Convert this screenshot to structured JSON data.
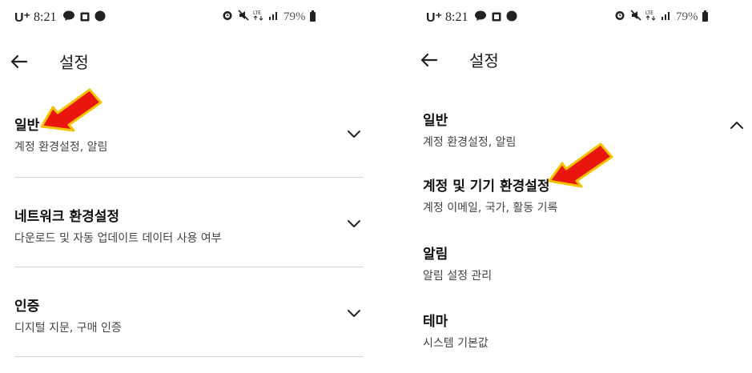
{
  "left": {
    "status": {
      "carrier": "U⁺",
      "time": "8:21",
      "battery": "79%"
    },
    "header": {
      "title": "설정"
    },
    "sections": [
      {
        "title": "일반",
        "subtitle": "계정 환경설정, 알림"
      },
      {
        "title": "네트워크 환경설정",
        "subtitle": "다운로드 및 자동 업데이트 데이터 사용 여부"
      },
      {
        "title": "인증",
        "subtitle": "디지털 지문, 구매 인증"
      }
    ]
  },
  "right": {
    "status": {
      "carrier": "U⁺",
      "time": "8:21",
      "battery": "79%"
    },
    "header": {
      "title": "설정"
    },
    "general": {
      "title": "일반",
      "subtitle": "계정 환경설정, 알림"
    },
    "subitems": [
      {
        "title": "계정 및 기기 환경설정",
        "subtitle": "계정 이메일, 국가, 활동 기록"
      },
      {
        "title": "알림",
        "subtitle": "알림 설정 관리"
      },
      {
        "title": "테마",
        "subtitle": "시스템 기본값"
      }
    ]
  },
  "colors": {
    "arrow_fill": "#e8160c",
    "arrow_outline": "#f5c400",
    "divider": "#d6d6d6"
  },
  "icons": [
    "back-arrow-icon",
    "chevron-down-icon",
    "chevron-up-icon",
    "alarm-icon",
    "mute-icon",
    "signal-icon",
    "battery-icon",
    "chat-icon",
    "talk-icon"
  ]
}
